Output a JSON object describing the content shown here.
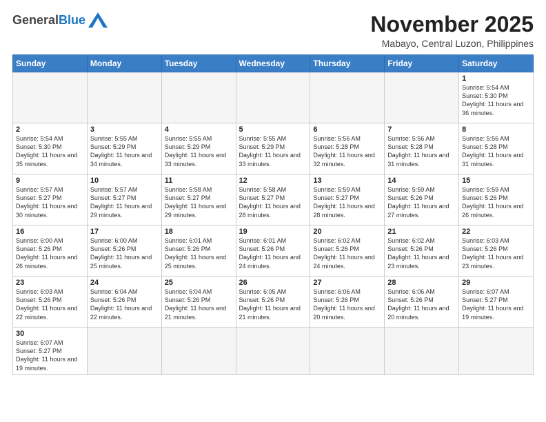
{
  "header": {
    "logo_general": "General",
    "logo_blue": "Blue",
    "month_title": "November 2025",
    "location": "Mabayo, Central Luzon, Philippines"
  },
  "days_of_week": [
    "Sunday",
    "Monday",
    "Tuesday",
    "Wednesday",
    "Thursday",
    "Friday",
    "Saturday"
  ],
  "weeks": [
    [
      {
        "num": "",
        "info": ""
      },
      {
        "num": "",
        "info": ""
      },
      {
        "num": "",
        "info": ""
      },
      {
        "num": "",
        "info": ""
      },
      {
        "num": "",
        "info": ""
      },
      {
        "num": "",
        "info": ""
      },
      {
        "num": "1",
        "info": "Sunrise: 5:54 AM\nSunset: 5:30 PM\nDaylight: 11 hours and 36 minutes."
      }
    ],
    [
      {
        "num": "2",
        "info": "Sunrise: 5:54 AM\nSunset: 5:30 PM\nDaylight: 11 hours and 35 minutes."
      },
      {
        "num": "3",
        "info": "Sunrise: 5:55 AM\nSunset: 5:29 PM\nDaylight: 11 hours and 34 minutes."
      },
      {
        "num": "4",
        "info": "Sunrise: 5:55 AM\nSunset: 5:29 PM\nDaylight: 11 hours and 33 minutes."
      },
      {
        "num": "5",
        "info": "Sunrise: 5:55 AM\nSunset: 5:29 PM\nDaylight: 11 hours and 33 minutes."
      },
      {
        "num": "6",
        "info": "Sunrise: 5:56 AM\nSunset: 5:28 PM\nDaylight: 11 hours and 32 minutes."
      },
      {
        "num": "7",
        "info": "Sunrise: 5:56 AM\nSunset: 5:28 PM\nDaylight: 11 hours and 31 minutes."
      },
      {
        "num": "8",
        "info": "Sunrise: 5:56 AM\nSunset: 5:28 PM\nDaylight: 11 hours and 31 minutes."
      }
    ],
    [
      {
        "num": "9",
        "info": "Sunrise: 5:57 AM\nSunset: 5:27 PM\nDaylight: 11 hours and 30 minutes."
      },
      {
        "num": "10",
        "info": "Sunrise: 5:57 AM\nSunset: 5:27 PM\nDaylight: 11 hours and 29 minutes."
      },
      {
        "num": "11",
        "info": "Sunrise: 5:58 AM\nSunset: 5:27 PM\nDaylight: 11 hours and 29 minutes."
      },
      {
        "num": "12",
        "info": "Sunrise: 5:58 AM\nSunset: 5:27 PM\nDaylight: 11 hours and 28 minutes."
      },
      {
        "num": "13",
        "info": "Sunrise: 5:59 AM\nSunset: 5:27 PM\nDaylight: 11 hours and 28 minutes."
      },
      {
        "num": "14",
        "info": "Sunrise: 5:59 AM\nSunset: 5:26 PM\nDaylight: 11 hours and 27 minutes."
      },
      {
        "num": "15",
        "info": "Sunrise: 5:59 AM\nSunset: 5:26 PM\nDaylight: 11 hours and 26 minutes."
      }
    ],
    [
      {
        "num": "16",
        "info": "Sunrise: 6:00 AM\nSunset: 5:26 PM\nDaylight: 11 hours and 26 minutes."
      },
      {
        "num": "17",
        "info": "Sunrise: 6:00 AM\nSunset: 5:26 PM\nDaylight: 11 hours and 25 minutes."
      },
      {
        "num": "18",
        "info": "Sunrise: 6:01 AM\nSunset: 5:26 PM\nDaylight: 11 hours and 25 minutes."
      },
      {
        "num": "19",
        "info": "Sunrise: 6:01 AM\nSunset: 5:26 PM\nDaylight: 11 hours and 24 minutes."
      },
      {
        "num": "20",
        "info": "Sunrise: 6:02 AM\nSunset: 5:26 PM\nDaylight: 11 hours and 24 minutes."
      },
      {
        "num": "21",
        "info": "Sunrise: 6:02 AM\nSunset: 5:26 PM\nDaylight: 11 hours and 23 minutes."
      },
      {
        "num": "22",
        "info": "Sunrise: 6:03 AM\nSunset: 5:26 PM\nDaylight: 11 hours and 23 minutes."
      }
    ],
    [
      {
        "num": "23",
        "info": "Sunrise: 6:03 AM\nSunset: 5:26 PM\nDaylight: 11 hours and 22 minutes."
      },
      {
        "num": "24",
        "info": "Sunrise: 6:04 AM\nSunset: 5:26 PM\nDaylight: 11 hours and 22 minutes."
      },
      {
        "num": "25",
        "info": "Sunrise: 6:04 AM\nSunset: 5:26 PM\nDaylight: 11 hours and 21 minutes."
      },
      {
        "num": "26",
        "info": "Sunrise: 6:05 AM\nSunset: 5:26 PM\nDaylight: 11 hours and 21 minutes."
      },
      {
        "num": "27",
        "info": "Sunrise: 6:06 AM\nSunset: 5:26 PM\nDaylight: 11 hours and 20 minutes."
      },
      {
        "num": "28",
        "info": "Sunrise: 6:06 AM\nSunset: 5:26 PM\nDaylight: 11 hours and 20 minutes."
      },
      {
        "num": "29",
        "info": "Sunrise: 6:07 AM\nSunset: 5:27 PM\nDaylight: 11 hours and 19 minutes."
      }
    ],
    [
      {
        "num": "30",
        "info": "Sunrise: 6:07 AM\nSunset: 5:27 PM\nDaylight: 11 hours and 19 minutes."
      },
      {
        "num": "",
        "info": ""
      },
      {
        "num": "",
        "info": ""
      },
      {
        "num": "",
        "info": ""
      },
      {
        "num": "",
        "info": ""
      },
      {
        "num": "",
        "info": ""
      },
      {
        "num": "",
        "info": ""
      }
    ]
  ]
}
